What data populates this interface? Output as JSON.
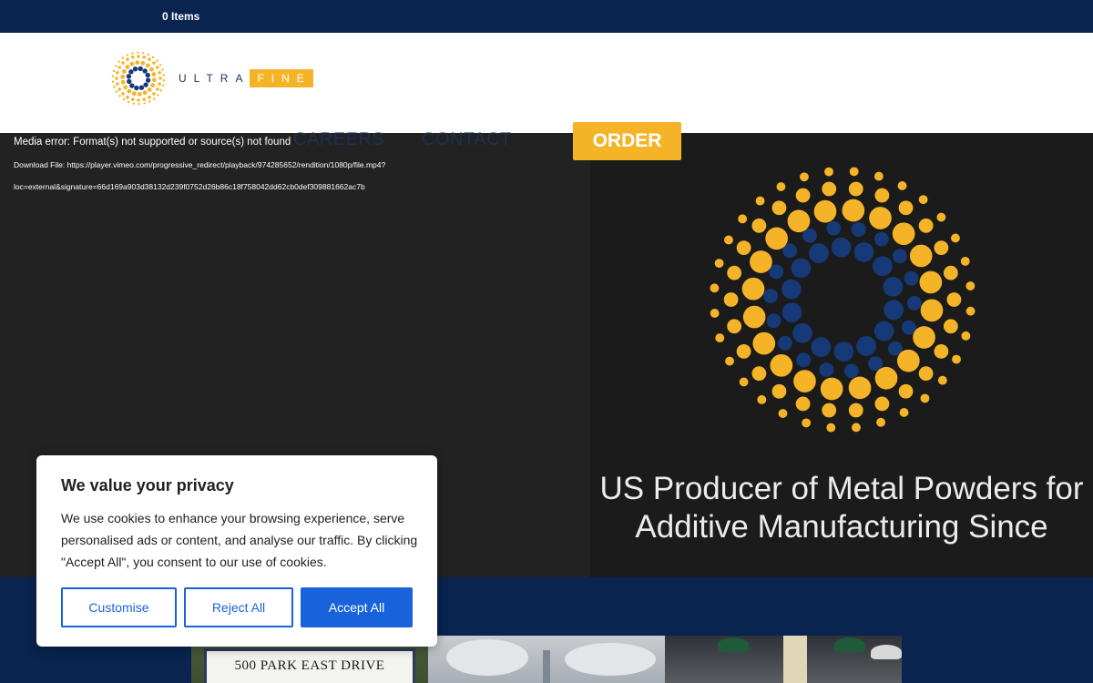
{
  "topbar": {
    "cart_label": "0 Items"
  },
  "brand": {
    "wordmark_ultra": "ULTRA",
    "wordmark_fine": "FINE",
    "colors": {
      "gold": "#f5b428",
      "navy": "#0a2450",
      "logo_blue": "#163a78"
    }
  },
  "nav": {
    "careers": "CAREERS",
    "contact": "CONTACT",
    "order_button": "ORDER"
  },
  "media": {
    "error": "Media error: Format(s) not supported or source(s) not found",
    "download_line1": "Download File: https://player.vimeo.com/progressive_redirect/playback/974285652/rendition/1080p/file.mp4?",
    "download_line2": "loc=external&signature=66d169a903d38132d239f0752d26b86c18f758042dd62cb0def309881662ac7b"
  },
  "hero": {
    "headline": "US Producer of Metal Powders for Additive Manufacturing Since"
  },
  "photos": {
    "sign_text": "500 PARK EAST DRIVE"
  },
  "cookie_banner": {
    "title": "We value your privacy",
    "body": "We use cookies to enhance your browsing experience, serve personalised ads or content, and analyse our traffic. By clicking \"Accept All\", you consent to our use of cookies.",
    "customise": "Customise",
    "reject": "Reject All",
    "accept": "Accept All",
    "accent": "#1863dc"
  },
  "icons": {
    "logo": "sunburst-dot-icon",
    "hero_graphic": "sunburst-dot-icon"
  }
}
